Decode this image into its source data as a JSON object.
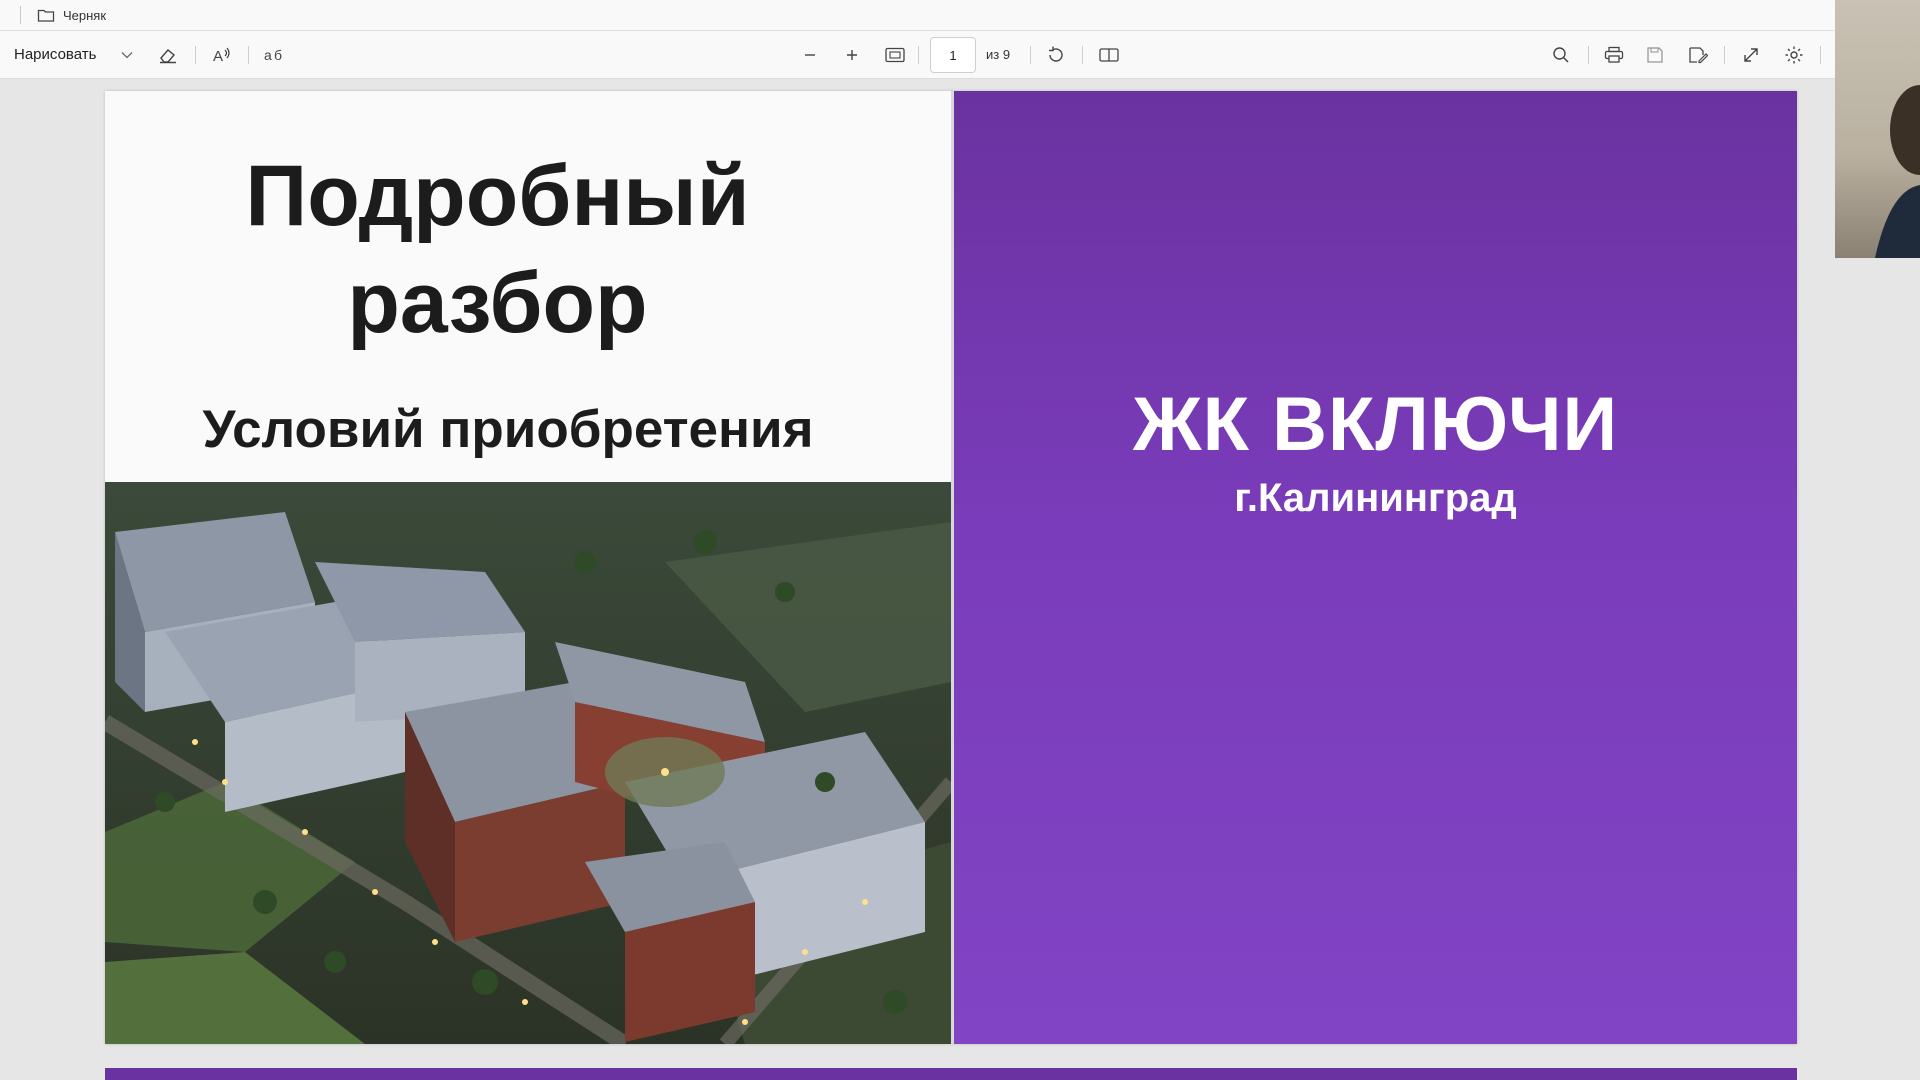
{
  "titlebar": {
    "folder_name": "Черняк"
  },
  "toolbar": {
    "draw_label": "Нарисовать",
    "page_current": "1",
    "page_total_label": "из 9"
  },
  "slide_left": {
    "title_line1": "Подробный",
    "title_line2": "разбор",
    "subtitle": "Условий приобретения"
  },
  "slide_right": {
    "brand": "ЖК ВКЛЮЧИ",
    "city": "г.Калининград"
  },
  "colors": {
    "accent_purple": "#7a3cba",
    "toolbar_bg": "#f9f9f9",
    "doc_bg": "#e6e6e6"
  },
  "icons": [
    "folder-icon",
    "chevron-down-icon",
    "eraser-icon",
    "read-aloud-icon",
    "translate-icon",
    "zoom-out-icon",
    "zoom-in-icon",
    "fit-page-icon",
    "rotate-icon",
    "page-view-icon",
    "search-icon",
    "print-icon",
    "save-icon",
    "save-as-icon",
    "fullscreen-icon",
    "settings-icon"
  ]
}
